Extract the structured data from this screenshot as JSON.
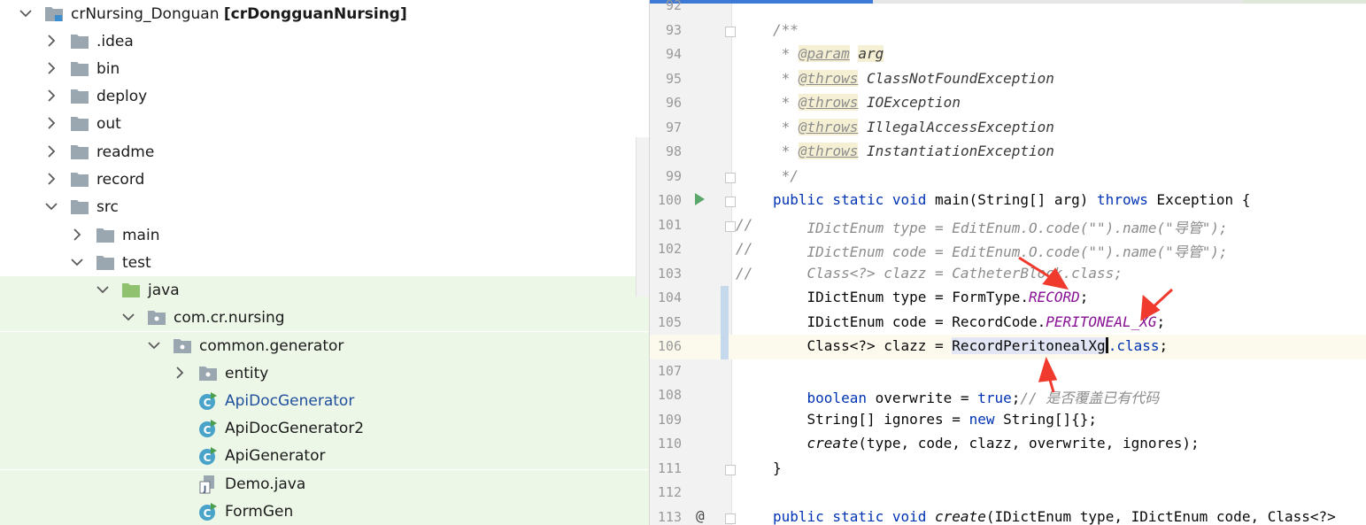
{
  "project_tree": {
    "rows": [
      {
        "label": "crNursing_Donguan",
        "label_bold": "[crDongguanNursing]",
        "icon": "module-folder-icon",
        "arrow": "down"
      },
      {
        "label": ".idea",
        "icon": "folder-icon",
        "arrow": "right"
      },
      {
        "label": "bin",
        "icon": "folder-icon",
        "arrow": "right"
      },
      {
        "label": "deploy",
        "icon": "folder-icon",
        "arrow": "right"
      },
      {
        "label": "out",
        "icon": "folder-icon",
        "arrow": "right"
      },
      {
        "label": "readme",
        "icon": "folder-icon",
        "arrow": "right"
      },
      {
        "label": "record",
        "icon": "folder-icon",
        "arrow": "right"
      },
      {
        "label": "src",
        "icon": "folder-icon",
        "arrow": "down"
      },
      {
        "label": "main",
        "icon": "folder-icon",
        "arrow": "right"
      },
      {
        "label": "test",
        "icon": "folder-icon",
        "arrow": "down"
      },
      {
        "label": "java",
        "icon": "test-source-folder-icon",
        "arrow": "down"
      },
      {
        "label": "com.cr.nursing",
        "icon": "package-icon",
        "arrow": "down"
      },
      {
        "label": "common.generator",
        "icon": "package-icon",
        "arrow": "down"
      },
      {
        "label": "entity",
        "icon": "package-icon",
        "arrow": "right"
      },
      {
        "label": "ApiDocGenerator",
        "icon": "runnable-class-icon",
        "arrow": "none"
      },
      {
        "label": "ApiDocGenerator2",
        "icon": "runnable-class-icon",
        "arrow": "none"
      },
      {
        "label": "ApiGenerator",
        "icon": "runnable-class-icon",
        "arrow": "none"
      },
      {
        "label": "Demo.java",
        "icon": "java-file-icon",
        "arrow": "none"
      },
      {
        "label": "FormGen",
        "icon": "runnable-class-icon",
        "arrow": "none"
      }
    ]
  },
  "editor": {
    "lines": [
      {
        "num": "92"
      },
      {
        "num": "93",
        "t": "/**"
      },
      {
        "num": "94",
        "tag": "@param",
        "rest": "arg"
      },
      {
        "num": "95",
        "tag": "@throws",
        "rest": "ClassNotFoundException"
      },
      {
        "num": "96",
        "tag": "@throws",
        "rest": "IOException"
      },
      {
        "num": "97",
        "tag": "@throws",
        "rest": "IllegalAccessException"
      },
      {
        "num": "98",
        "tag": "@throws",
        "rest": "InstantiationException"
      },
      {
        "num": "99",
        "t": "*/"
      },
      {
        "num": "100",
        "kw1": "public static void",
        "mid": " main(String[] arg) ",
        "kw2": "throws",
        "end": " Exception {"
      },
      {
        "num": "101",
        "comment": "    IDictEnum type = EditEnum.O.code(\"\").name(\"导管\");"
      },
      {
        "num": "102",
        "comment": "    IDictEnum code = EditEnum.O.code(\"\").name(\"导管\");"
      },
      {
        "num": "103",
        "comment": "    Class<?> clazz = CatheterBlock.class;"
      },
      {
        "num": "104",
        "pre": "    IDictEnum type = FormType.",
        "const": "RECORD",
        "post": ";"
      },
      {
        "num": "105",
        "pre": "    IDictEnum code = RecordCode.",
        "const": "PERITONEAL_XG",
        "post": ";"
      },
      {
        "num": "106",
        "pre": "    Class<?> clazz = ",
        "sel": "RecordPeritonealXg",
        "kwc": ".class",
        "post": ";"
      },
      {
        "num": "107"
      },
      {
        "num": "108",
        "kw1": "    boolean",
        "mid": " overwrite = ",
        "kw2": "true",
        "end": ";",
        "cmt": "// 是否覆盖已有代码"
      },
      {
        "num": "109",
        "mid": "    String[] ignores = ",
        "kw2": "new",
        "end": " String[]{};"
      },
      {
        "num": "110",
        "italic": "    create",
        "end": "(type, code, clazz, overwrite, ignores);"
      },
      {
        "num": "111",
        "t": "}"
      },
      {
        "num": "112"
      },
      {
        "num": "113",
        "kw1": "public static void",
        "italic": " create",
        "end": "(IDictEnum type, IDictEnum code, Class<?>"
      }
    ],
    "comment_prefix": "//",
    "annotation_mark": "@"
  },
  "colors": {
    "keyword": "#0033b3",
    "comment": "#8c8c8c",
    "constant": "#871094",
    "arrow": "#f03a2e",
    "tree_highlight": "#edf7e8",
    "link": "#1f4f9c"
  }
}
